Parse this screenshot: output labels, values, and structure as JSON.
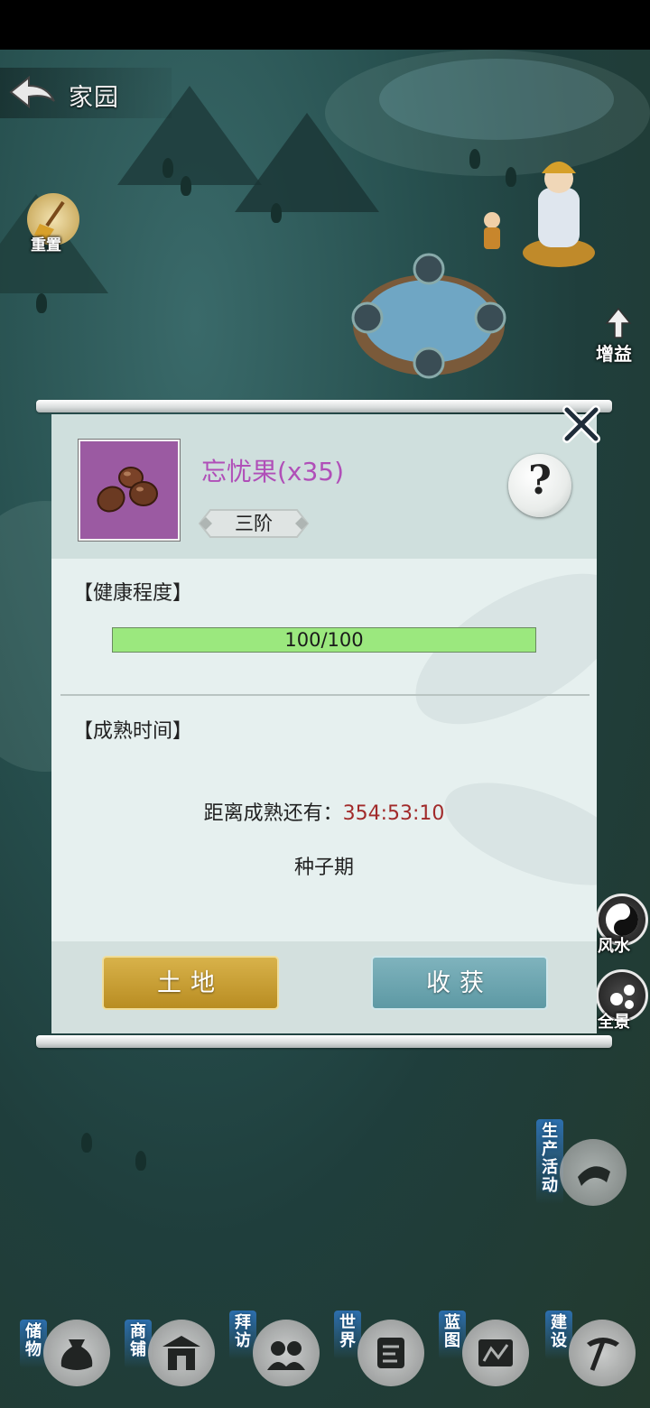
{
  "scene": {
    "title": "家园",
    "left_buttons": [
      {
        "label": "重置",
        "icon": "broom-icon"
      }
    ],
    "right_buttons": [
      {
        "label": "增益",
        "icon": "arrow-up-icon"
      },
      {
        "label": "风水",
        "icon": "yin-yang-icon"
      },
      {
        "label": "全景",
        "icon": "panorama-icon"
      }
    ],
    "production_label": "生产活动",
    "dock": [
      {
        "label": "储物",
        "icon": "bag-icon"
      },
      {
        "label": "商铺",
        "icon": "shop-icon"
      },
      {
        "label": "拜访",
        "icon": "visit-icon"
      },
      {
        "label": "世界",
        "icon": "scroll-icon"
      },
      {
        "label": "蓝图",
        "icon": "blueprint-icon"
      },
      {
        "label": "建设",
        "icon": "pickaxe-icon"
      }
    ]
  },
  "dialog": {
    "item_name": "忘忧果(x35)",
    "item_icon": "fruit-icon",
    "tier": "三阶",
    "help_icon": "question-icon",
    "close_icon": "close-icon",
    "health_title": "【健康程度】",
    "health_text": "100/100",
    "health_ratio": 1.0,
    "maturity_title": "【成熟时间】",
    "maturity_label": "距离成熟还有：",
    "maturity_value": "354:53:10",
    "stage": "种子期",
    "buttons": {
      "land": "土地",
      "harvest": "收获"
    }
  },
  "colors": {
    "item_name": "#b04fb8",
    "health_bar": "#9be87e",
    "maturity_value": "#a12a2a",
    "land_button": "#c9a032",
    "harvest_button": "#6ea6b0"
  }
}
